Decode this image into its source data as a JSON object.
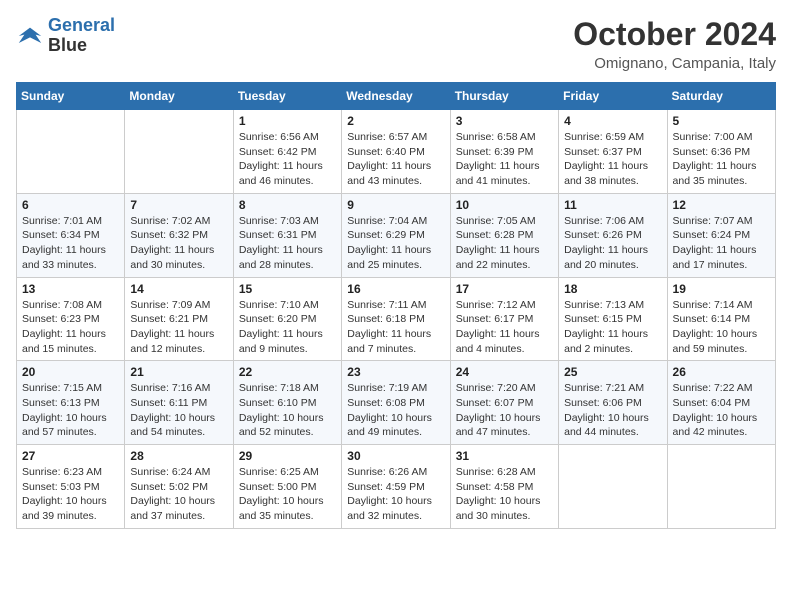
{
  "header": {
    "logo_line1": "General",
    "logo_line2": "Blue",
    "month_title": "October 2024",
    "location": "Omignano, Campania, Italy"
  },
  "days_of_week": [
    "Sunday",
    "Monday",
    "Tuesday",
    "Wednesday",
    "Thursday",
    "Friday",
    "Saturday"
  ],
  "weeks": [
    [
      {
        "day": "",
        "info": ""
      },
      {
        "day": "",
        "info": ""
      },
      {
        "day": "1",
        "info": "Sunrise: 6:56 AM\nSunset: 6:42 PM\nDaylight: 11 hours and 46 minutes."
      },
      {
        "day": "2",
        "info": "Sunrise: 6:57 AM\nSunset: 6:40 PM\nDaylight: 11 hours and 43 minutes."
      },
      {
        "day": "3",
        "info": "Sunrise: 6:58 AM\nSunset: 6:39 PM\nDaylight: 11 hours and 41 minutes."
      },
      {
        "day": "4",
        "info": "Sunrise: 6:59 AM\nSunset: 6:37 PM\nDaylight: 11 hours and 38 minutes."
      },
      {
        "day": "5",
        "info": "Sunrise: 7:00 AM\nSunset: 6:36 PM\nDaylight: 11 hours and 35 minutes."
      }
    ],
    [
      {
        "day": "6",
        "info": "Sunrise: 7:01 AM\nSunset: 6:34 PM\nDaylight: 11 hours and 33 minutes."
      },
      {
        "day": "7",
        "info": "Sunrise: 7:02 AM\nSunset: 6:32 PM\nDaylight: 11 hours and 30 minutes."
      },
      {
        "day": "8",
        "info": "Sunrise: 7:03 AM\nSunset: 6:31 PM\nDaylight: 11 hours and 28 minutes."
      },
      {
        "day": "9",
        "info": "Sunrise: 7:04 AM\nSunset: 6:29 PM\nDaylight: 11 hours and 25 minutes."
      },
      {
        "day": "10",
        "info": "Sunrise: 7:05 AM\nSunset: 6:28 PM\nDaylight: 11 hours and 22 minutes."
      },
      {
        "day": "11",
        "info": "Sunrise: 7:06 AM\nSunset: 6:26 PM\nDaylight: 11 hours and 20 minutes."
      },
      {
        "day": "12",
        "info": "Sunrise: 7:07 AM\nSunset: 6:24 PM\nDaylight: 11 hours and 17 minutes."
      }
    ],
    [
      {
        "day": "13",
        "info": "Sunrise: 7:08 AM\nSunset: 6:23 PM\nDaylight: 11 hours and 15 minutes."
      },
      {
        "day": "14",
        "info": "Sunrise: 7:09 AM\nSunset: 6:21 PM\nDaylight: 11 hours and 12 minutes."
      },
      {
        "day": "15",
        "info": "Sunrise: 7:10 AM\nSunset: 6:20 PM\nDaylight: 11 hours and 9 minutes."
      },
      {
        "day": "16",
        "info": "Sunrise: 7:11 AM\nSunset: 6:18 PM\nDaylight: 11 hours and 7 minutes."
      },
      {
        "day": "17",
        "info": "Sunrise: 7:12 AM\nSunset: 6:17 PM\nDaylight: 11 hours and 4 minutes."
      },
      {
        "day": "18",
        "info": "Sunrise: 7:13 AM\nSunset: 6:15 PM\nDaylight: 11 hours and 2 minutes."
      },
      {
        "day": "19",
        "info": "Sunrise: 7:14 AM\nSunset: 6:14 PM\nDaylight: 10 hours and 59 minutes."
      }
    ],
    [
      {
        "day": "20",
        "info": "Sunrise: 7:15 AM\nSunset: 6:13 PM\nDaylight: 10 hours and 57 minutes."
      },
      {
        "day": "21",
        "info": "Sunrise: 7:16 AM\nSunset: 6:11 PM\nDaylight: 10 hours and 54 minutes."
      },
      {
        "day": "22",
        "info": "Sunrise: 7:18 AM\nSunset: 6:10 PM\nDaylight: 10 hours and 52 minutes."
      },
      {
        "day": "23",
        "info": "Sunrise: 7:19 AM\nSunset: 6:08 PM\nDaylight: 10 hours and 49 minutes."
      },
      {
        "day": "24",
        "info": "Sunrise: 7:20 AM\nSunset: 6:07 PM\nDaylight: 10 hours and 47 minutes."
      },
      {
        "day": "25",
        "info": "Sunrise: 7:21 AM\nSunset: 6:06 PM\nDaylight: 10 hours and 44 minutes."
      },
      {
        "day": "26",
        "info": "Sunrise: 7:22 AM\nSunset: 6:04 PM\nDaylight: 10 hours and 42 minutes."
      }
    ],
    [
      {
        "day": "27",
        "info": "Sunrise: 6:23 AM\nSunset: 5:03 PM\nDaylight: 10 hours and 39 minutes."
      },
      {
        "day": "28",
        "info": "Sunrise: 6:24 AM\nSunset: 5:02 PM\nDaylight: 10 hours and 37 minutes."
      },
      {
        "day": "29",
        "info": "Sunrise: 6:25 AM\nSunset: 5:00 PM\nDaylight: 10 hours and 35 minutes."
      },
      {
        "day": "30",
        "info": "Sunrise: 6:26 AM\nSunset: 4:59 PM\nDaylight: 10 hours and 32 minutes."
      },
      {
        "day": "31",
        "info": "Sunrise: 6:28 AM\nSunset: 4:58 PM\nDaylight: 10 hours and 30 minutes."
      },
      {
        "day": "",
        "info": ""
      },
      {
        "day": "",
        "info": ""
      }
    ]
  ]
}
